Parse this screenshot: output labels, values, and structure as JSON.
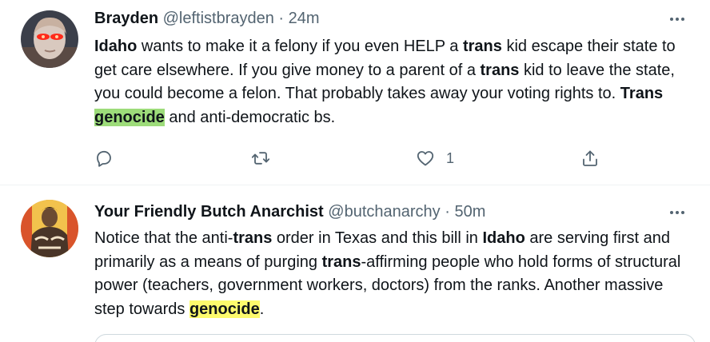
{
  "tweets": [
    {
      "name": "Brayden",
      "handle": "@leftistbrayden",
      "separator": "·",
      "time": "24m",
      "body": [
        {
          "t": "Idaho",
          "b": true
        },
        {
          "t": " wants to make it a felony if you even HELP a "
        },
        {
          "t": "trans",
          "b": true
        },
        {
          "t": " kid escape their state to get care elsewhere. If you give money to a parent of a "
        },
        {
          "t": "trans",
          "b": true
        },
        {
          "t": " kid to leave the state, you could become a felon. That probably takes away your voting rights to. "
        },
        {
          "t": "Trans",
          "b": true
        },
        {
          "t": " "
        },
        {
          "t": "genocide",
          "b": true,
          "hl": "green"
        },
        {
          "t": " and anti-democratic bs."
        }
      ],
      "actions": {
        "reply_icon": "reply-icon",
        "retweet_icon": "retweet-icon",
        "like_icon": "heart-icon",
        "like_count": "1",
        "share_icon": "share-icon"
      }
    },
    {
      "name": "Your Friendly Butch Anarchist",
      "handle": "@butchanarchy",
      "separator": "·",
      "time": "50m",
      "body": [
        {
          "t": "Notice that the anti-"
        },
        {
          "t": "trans",
          "b": true
        },
        {
          "t": " order in Texas and this bill in "
        },
        {
          "t": "Idaho",
          "b": true
        },
        {
          "t": " are serving first and primarily as a means of purging "
        },
        {
          "t": "trans",
          "b": true
        },
        {
          "t": "-affirming people who hold forms of structural power (teachers, government workers, doctors) from the ranks. Another massive step towards "
        },
        {
          "t": "genocide",
          "b": true,
          "hl": "yellow"
        },
        {
          "t": "."
        }
      ]
    }
  ],
  "colors": {
    "text": "#0f1419",
    "secondary": "#536471",
    "highlight_green": "#9ddc7a",
    "highlight_yellow": "#fdfb6d",
    "divider": "#eff3f4"
  }
}
